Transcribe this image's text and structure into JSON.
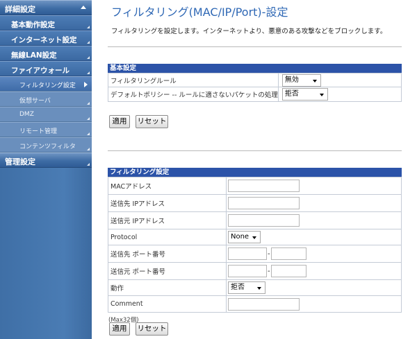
{
  "sidebar": {
    "items": [
      {
        "label": "詳細設定",
        "level": 1
      },
      {
        "label": "基本動作設定",
        "level": 2
      },
      {
        "label": "インターネット設定",
        "level": 2
      },
      {
        "label": "無線LAN設定",
        "level": 2
      },
      {
        "label": "ファイアウォール",
        "level": 2
      },
      {
        "label": "フィルタリング設定",
        "level": 3,
        "active": true
      },
      {
        "label": "仮想サーバ",
        "level": 3
      },
      {
        "label": "DMZ",
        "level": 3
      },
      {
        "label": "リモート管理",
        "level": 3
      },
      {
        "label": "コンテンツフィルタ",
        "level": 3
      },
      {
        "label": "管理設定",
        "level": 1
      }
    ]
  },
  "page": {
    "title": "フィルタリング(MAC/IP/Port)-設定",
    "description": "フィルタリングを設定します。インターネットより、悪意のある攻撃などをブロックします。"
  },
  "basic": {
    "header": "基本設定",
    "rule_label": "フィルタリングルール",
    "rule_value": "無効",
    "policy_label": "デフォルトポリシー -- ルールに適さないパケットの処理",
    "policy_value": "拒否",
    "apply_label": "適用",
    "reset_label": "リセット"
  },
  "filter": {
    "header": "フィルタリング設定",
    "mac_label": "MACアドレス",
    "mac_value": "",
    "dst_ip_label": "送信先 IPアドレス",
    "dst_ip_value": "",
    "src_ip_label": "送信元 IPアドレス",
    "src_ip_value": "",
    "protocol_label": "Protocol",
    "protocol_value": "None",
    "dst_port_label": "送信先 ポート番号",
    "dst_port_from": "",
    "dst_port_to": "",
    "port_separator": "-",
    "src_port_label": "送信元 ポート番号",
    "src_port_from": "",
    "src_port_to": "",
    "action_label": "動作",
    "action_value": "拒否",
    "comment_label": "Comment",
    "comment_value": "",
    "max_note": "(Max32個)",
    "apply_label": "適用",
    "reset_label": "リセット"
  },
  "colors": {
    "sidebar_bg": "#4a7cb4",
    "section_header": "#2c53a8",
    "title": "#2f68b5"
  }
}
